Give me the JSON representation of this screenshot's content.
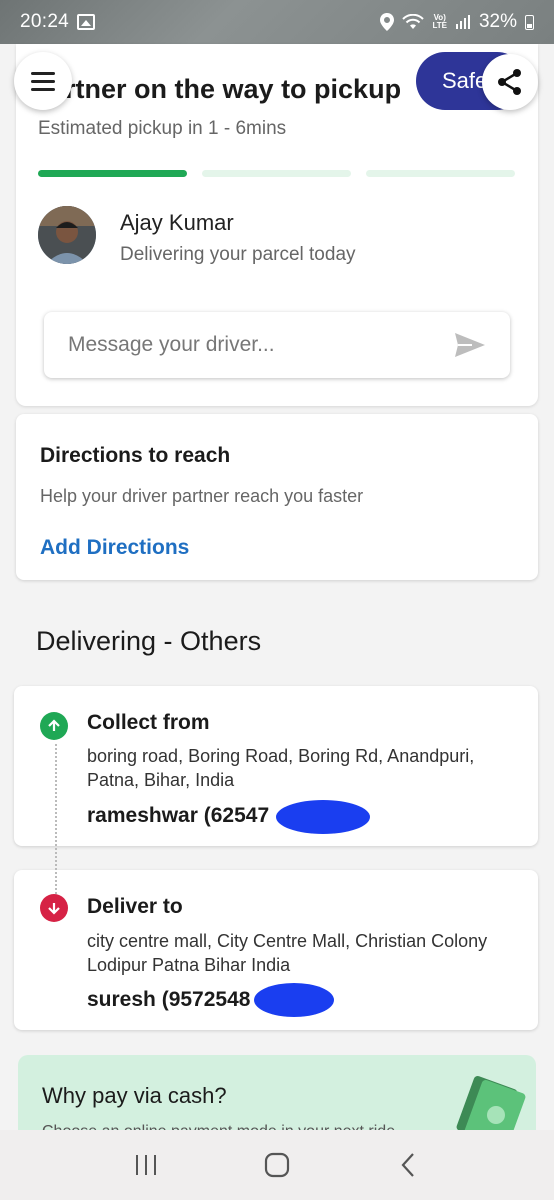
{
  "status_bar": {
    "time": "20:24",
    "battery": "32%",
    "network": "LTE"
  },
  "header": {
    "title": "Partner on the way to pickup",
    "subtitle": "Estimated pickup in 1 - 6mins",
    "safety_label": "Safety",
    "progress_segments": [
      {
        "state": "done",
        "color": "#1fa855"
      },
      {
        "state": "pending",
        "color": "#e4f5ea"
      },
      {
        "state": "pending",
        "color": "#e4f5ea"
      }
    ]
  },
  "driver": {
    "name": "Ajay Kumar",
    "subtitle": "Delivering your parcel today",
    "message_placeholder": "Message your driver..."
  },
  "directions": {
    "title": "Directions to reach",
    "subtitle": "Help your driver partner reach you faster",
    "link": "Add Directions"
  },
  "section": {
    "title": "Delivering - Others"
  },
  "pickup": {
    "title": "Collect from",
    "address": "boring road, Boring Road, Boring Rd, Anandpuri, Patna, Bihar, India",
    "contact": "rameshwar (62547",
    "color": "#1fa855"
  },
  "drop": {
    "title": "Deliver to",
    "address": "city centre mall, City Centre Mall, Christian Colony Lodipur Patna Bihar India",
    "contact": "suresh (9572548",
    "color": "#d62245"
  },
  "cash_promo": {
    "title": "Why pay via cash?",
    "subtitle": "Choose an online payment mode in your next ride"
  },
  "colors": {
    "accent_blue": "#2e3598",
    "link_blue": "#1f6fc2",
    "green": "#1fa855",
    "red": "#d62245"
  }
}
